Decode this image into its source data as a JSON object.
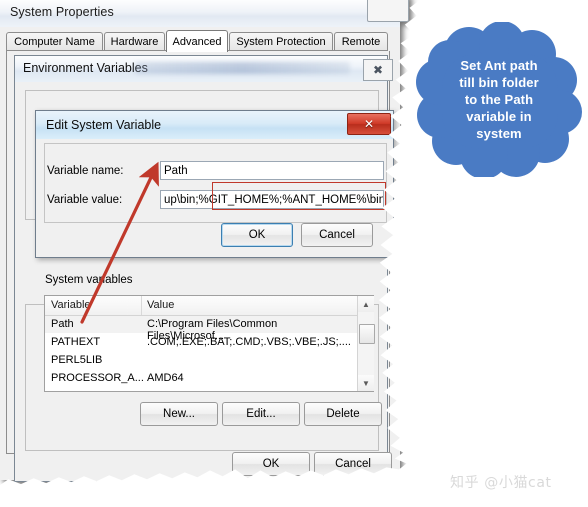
{
  "system_properties": {
    "title": "System Properties",
    "tabs": [
      {
        "label": "Computer Name",
        "active": false
      },
      {
        "label": "Hardware",
        "active": false
      },
      {
        "label": "Advanced",
        "active": true
      },
      {
        "label": "System Protection",
        "active": false
      },
      {
        "label": "Remote",
        "active": false
      }
    ]
  },
  "environment_variables": {
    "title": "Environment Variables",
    "close_icon": "close-icon",
    "system_variables_legend": "System variables",
    "columns": [
      "Variable",
      "Value"
    ],
    "rows": [
      {
        "variable": "Path",
        "value": "C:\\Program Files\\Common Files\\Microsof...",
        "selected": true
      },
      {
        "variable": "PATHEXT",
        "value": ".COM;.EXE;.BAT;.CMD;.VBS;.VBE;.JS;....",
        "selected": false
      },
      {
        "variable": "PERL5LIB",
        "value": "",
        "selected": false
      },
      {
        "variable": "PROCESSOR_A...",
        "value": "AMD64",
        "selected": false
      }
    ],
    "list_buttons": [
      {
        "label": "New..."
      },
      {
        "label": "Edit..."
      },
      {
        "label": "Delete"
      }
    ],
    "dialog_buttons": [
      {
        "label": "OK"
      },
      {
        "label": "Cancel"
      }
    ]
  },
  "edit_system_variable": {
    "title": "Edit System Variable",
    "close_icon": "close-icon",
    "close_glyph": "✕",
    "name_label": "Variable name:",
    "name_value": "Path",
    "value_label": "Variable value:",
    "value_value": "up\\bin;%GIT_HOME%;%ANT_HOME%\\bin",
    "highlight_color": "#c0392b",
    "ok_label": "OK",
    "cancel_label": "Cancel"
  },
  "callout": {
    "lines": [
      "Set Ant path",
      "till bin folder",
      "to the Path",
      "variable in",
      "system"
    ],
    "color": "#4a7bc4"
  },
  "annotation": {
    "arrow_color": "#c0392b"
  },
  "watermark": {
    "text": "知乎 @小猫cat"
  },
  "scrollbar": {
    "up_glyph": "▲",
    "down_glyph": "▼"
  }
}
